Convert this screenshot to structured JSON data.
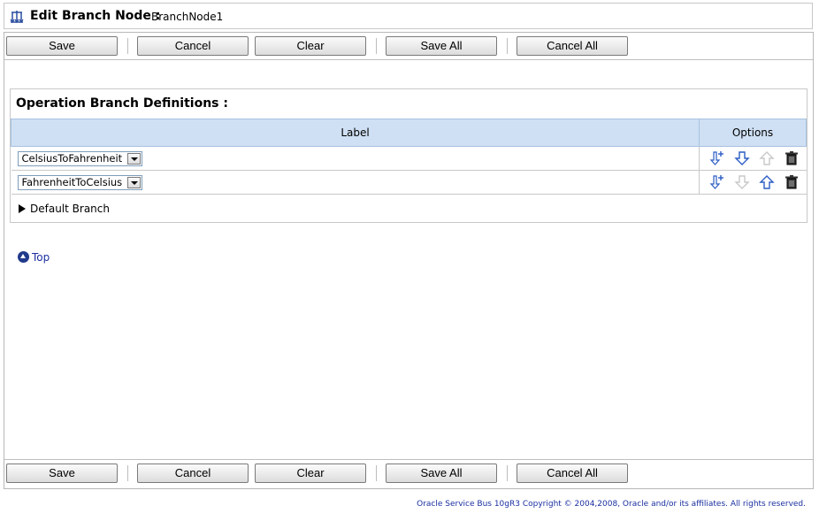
{
  "header": {
    "title": "Edit Branch Node",
    "separator": ":",
    "node_name": "BranchNode1"
  },
  "toolbar": {
    "save": "Save",
    "cancel": "Cancel",
    "clear": "Clear",
    "save_all": "Save All",
    "cancel_all": "Cancel All"
  },
  "section": {
    "title": "Operation Branch Definitions :",
    "columns": {
      "label": "Label",
      "options": "Options"
    },
    "rows": [
      {
        "label": "CelsiusToFahrenheit",
        "up_enabled": false,
        "down_enabled": true
      },
      {
        "label": "FahrenheitToCelsius",
        "up_enabled": true,
        "down_enabled": false
      }
    ],
    "default_branch": "Default Branch"
  },
  "top_link": "Top",
  "footer": "Oracle Service Bus 10gR3 Copyright © 2004,2008, Oracle and/or its affiliates. All rights reserved.",
  "icons": {
    "header": "branch-node-icon",
    "add": "insert-below-icon",
    "down": "move-down-icon",
    "up": "move-up-icon",
    "delete": "trash-icon"
  },
  "colors": {
    "header_row": "#cfe0f4",
    "link": "#1a2fa0",
    "arrow_active": "#2b5cc4",
    "arrow_disabled": "#c8c8c8"
  }
}
